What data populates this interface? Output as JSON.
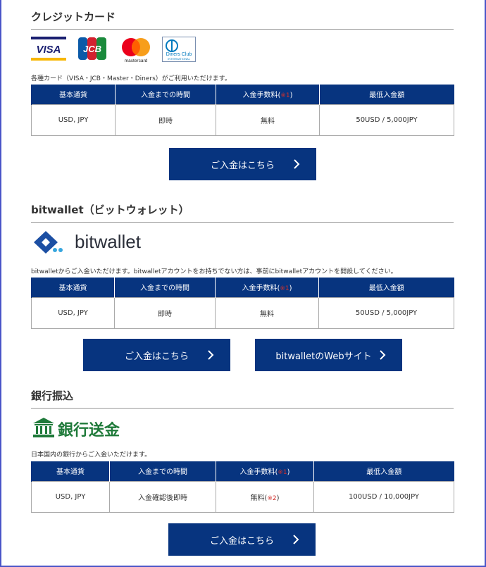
{
  "sections": [
    {
      "title": "クレジットカード",
      "desc": "各種カード（VISA・JCB・Master・Diners）がご利用いただけます。",
      "headers": [
        "基本通貨",
        "入金までの時間",
        "入金手数料(",
        "最低入金額"
      ],
      "note": "※1",
      "row": [
        "USD, JPY",
        "即時",
        "無料",
        "50USD / 5,000JPY"
      ],
      "button": "ご入金はこちら"
    },
    {
      "title": "bitwallet（ビットウォレット）",
      "logo_text": "bitwallet",
      "desc": "bitwalletからご入金いただけます。bitwalletアカウントをお持ちでない方は、事前にbitwalletアカウントを開設してください。",
      "headers": [
        "基本通貨",
        "入金までの時間",
        "入金手数料(",
        "最低入金額"
      ],
      "note": "※1",
      "row": [
        "USD, JPY",
        "即時",
        "無料",
        "50USD / 5,000JPY"
      ],
      "button": "ご入金はこちら",
      "button2": "bitwalletのWebサイト"
    },
    {
      "title": "銀行振込",
      "logo_text": "銀行送金",
      "desc": "日本国内の銀行からご入金いただけます。",
      "headers": [
        "基本通貨",
        "入金までの時間",
        "入金手数料(",
        "最低入金額"
      ],
      "note": "※1",
      "row": [
        "USD, JPY",
        "入金確認後即時",
        "無料(",
        "100USD / 10,000JPY"
      ],
      "row_note": "※2",
      "button": "ご入金はこちら"
    }
  ],
  "card_logos": {
    "visa": "VISA",
    "jcb": "JCB",
    "mastercard": "mastercard",
    "diners": "Diners Club",
    "diners_sub": "INTERNATIONAL"
  },
  "colors": {
    "accent": "#07347f",
    "note": "#d0312d",
    "bank_green": "#1f7a3a",
    "frame": "#4a55c8"
  }
}
